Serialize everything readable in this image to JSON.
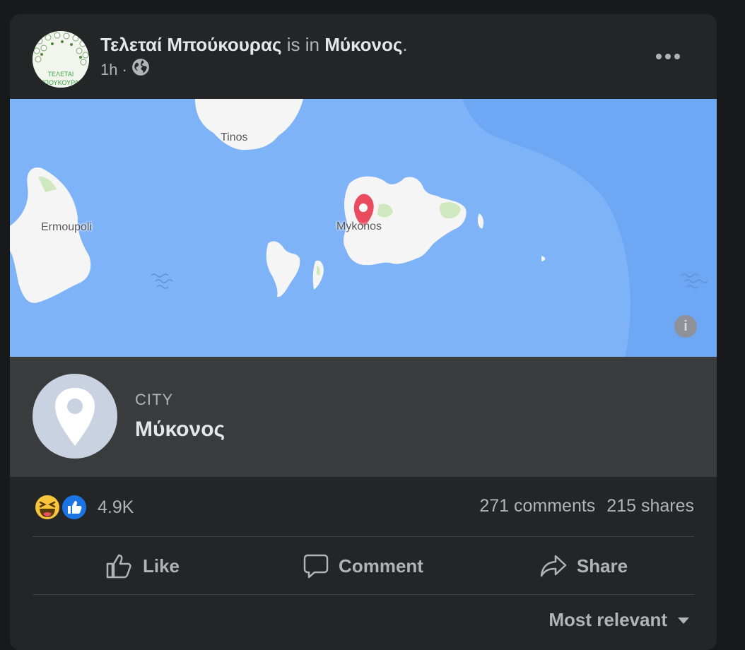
{
  "post": {
    "author": "Τελεταί Μπούκουρας",
    "connector": "is in",
    "location": "Μύκονος",
    "period": ".",
    "time": "1h",
    "separator": "·",
    "avatar_text_1": "ΤΕΛΕΤΑΙ",
    "avatar_text_2": "ΜΠΟΥΚΟΥΡΑΣ"
  },
  "map": {
    "labels": {
      "tinos": "Tinos",
      "ermoupoli": "Ermoupoli",
      "mykonos": "Mykonos"
    },
    "info_icon": "i",
    "colors": {
      "sea": "#7fb3f7",
      "deep_sea": "#6ea8f5",
      "land": "#f5f5f5",
      "park": "#cfe8c0",
      "pin": "#ea4c5f"
    }
  },
  "place": {
    "type": "CITY",
    "name": "Μύκονος"
  },
  "engagement": {
    "reactions_count": "4.9K",
    "comments": "271 comments",
    "shares": "215 shares"
  },
  "actions": {
    "like": "Like",
    "comment": "Comment",
    "share": "Share"
  },
  "comments_sort": {
    "label": "Most relevant"
  },
  "icons": {
    "more": "more-options-icon",
    "privacy": "globe-icon",
    "pin": "map-pin-icon",
    "haha": "haha-reaction-icon",
    "like_reaction": "like-reaction-icon",
    "like": "thumbs-up-icon",
    "comment": "speech-bubble-icon",
    "share": "share-arrow-icon",
    "sort": "caret-down-icon"
  }
}
